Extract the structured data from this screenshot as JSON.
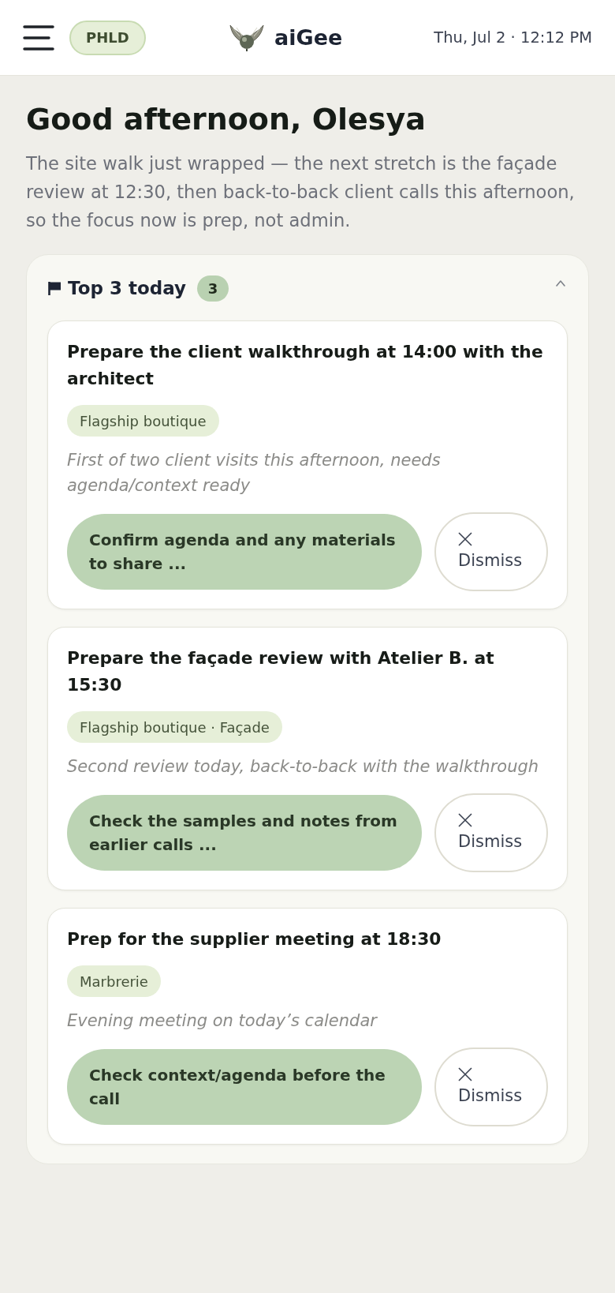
{
  "header": {
    "badge": "PHLD",
    "brand": "aiGee",
    "datetime": "Thu, Jul 2 · 12:12 PM"
  },
  "greeting": {
    "title": "Good afternoon, Olesya",
    "summary": "The site walk just wrapped — the next stretch is the façade review at 12:30, then back-to-back client calls this afternoon, so the focus now is prep, not admin."
  },
  "top_tasks": {
    "title": "Top 3 today",
    "count": "3",
    "expanded": true,
    "items": [
      {
        "title": "Prepare the client walkthrough at 14:00 with the architect",
        "tag": "Flagship boutique",
        "note": "First of two client visits this afternoon, needs agenda/context ready",
        "action": "Confirm agenda and any materials to share ...",
        "dismiss": "Dismiss"
      },
      {
        "title": "Prepare the façade review with Atelier B. at 15:30",
        "tag": "Flagship boutique · Façade",
        "note": "Second review today, back-to-back with the walkthrough",
        "action": "Check the samples and notes from earlier calls ...",
        "dismiss": "Dismiss"
      },
      {
        "title": "Prep for the supplier meeting at 18:30",
        "tag": "Marbrerie",
        "note": "Evening meeting on today’s calendar",
        "action": "Check context/agenda before the call",
        "dismiss": "Dismiss"
      }
    ]
  }
}
